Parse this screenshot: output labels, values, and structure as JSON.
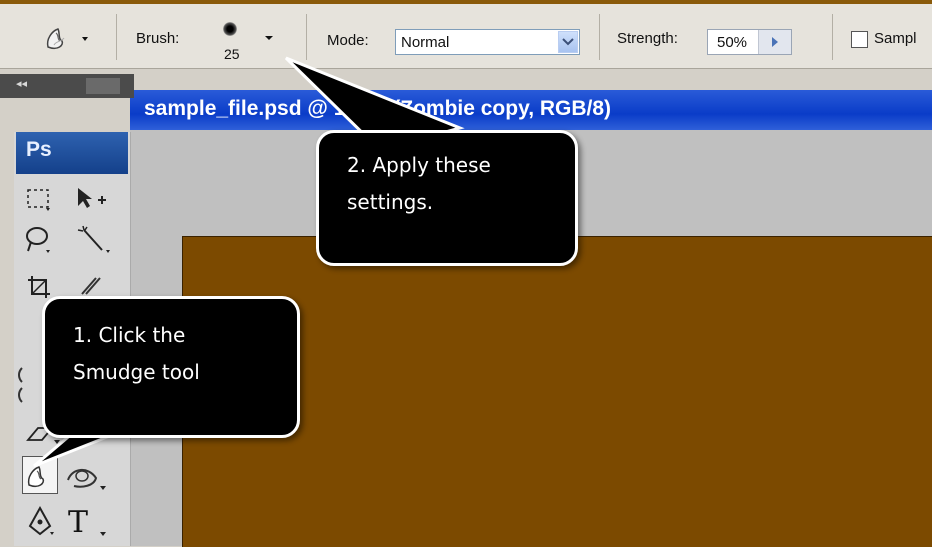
{
  "options_bar": {
    "tool_preset_icon": "smudge-icon",
    "brush_label": "Brush:",
    "brush_size": "25",
    "mode_label": "Mode:",
    "mode_value": "Normal",
    "strength_label": "Strength:",
    "strength_value": "50%",
    "sample_label": "Sampl"
  },
  "document": {
    "title": "sample_file.psd @ 100% (Zombie copy, RGB/8)",
    "canvas_color": "#7c4a00"
  },
  "toolbox": {
    "logo": "Ps",
    "collapse": "◂◂",
    "tools": [
      "marquee-icon",
      "move-icon",
      "lasso-icon",
      "magic-wand-icon",
      "crop-icon",
      "slice-icon",
      "eraser-icon",
      "smudge-icon",
      "dodge-icon",
      "pen-icon",
      "type-icon"
    ]
  },
  "callouts": {
    "step1_line1": "1. Click the",
    "step1_line2": "Smudge tool",
    "step2_line1": "2. Apply these",
    "step2_line2": "settings."
  }
}
